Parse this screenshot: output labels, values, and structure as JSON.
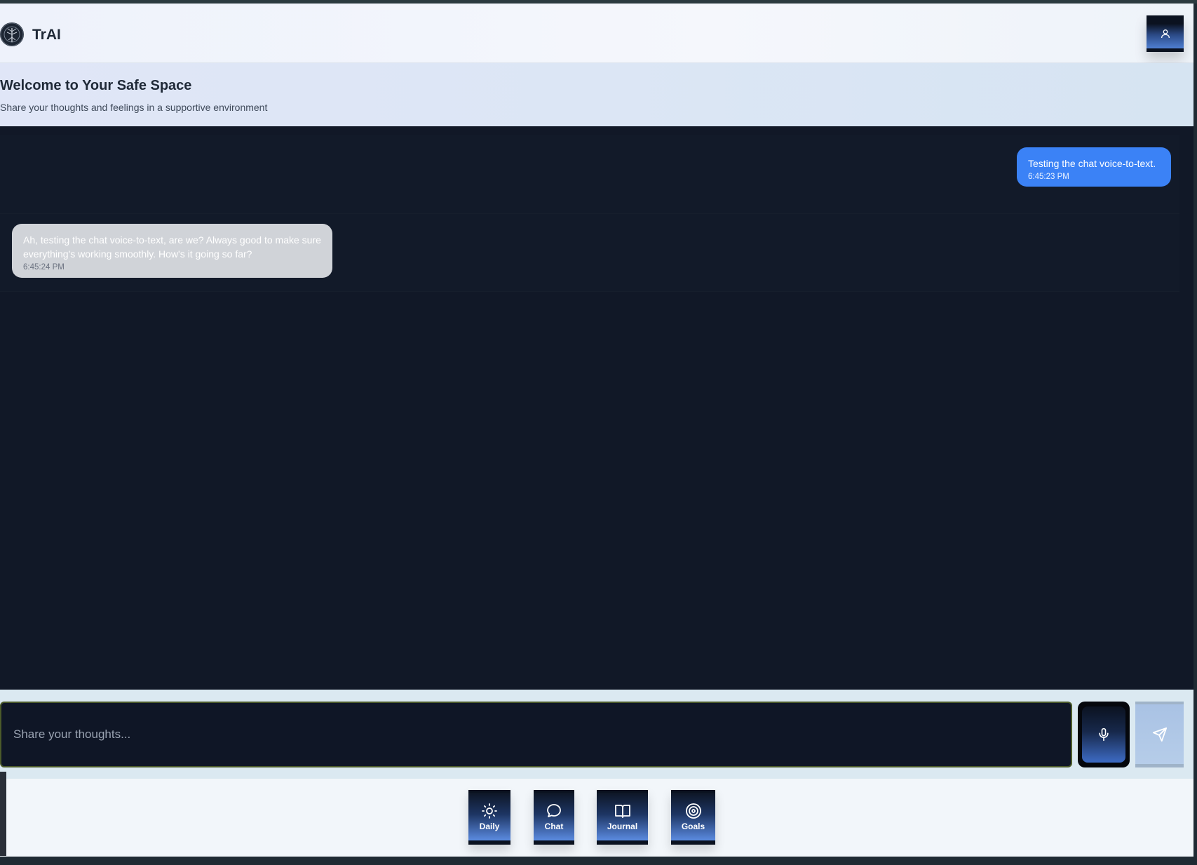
{
  "app": {
    "title": "TrAI"
  },
  "welcome": {
    "title": "Welcome to Your Safe Space",
    "subtitle": "Share your thoughts and feelings in a supportive environment"
  },
  "messages": [
    {
      "sender": "user",
      "text": "Testing the chat voice-to-text.",
      "time": "6:45:23 PM"
    },
    {
      "sender": "assistant",
      "text": "Ah, testing the chat voice-to-text, are we? Always good to make sure everything's working smoothly. How's it going so far?",
      "time": "6:45:24 PM"
    }
  ],
  "input": {
    "placeholder": "Share your thoughts..."
  },
  "nav": {
    "items": [
      {
        "label": "Daily",
        "icon": "sun-icon"
      },
      {
        "label": "Chat",
        "icon": "chat-bubble-icon"
      },
      {
        "label": "Journal",
        "icon": "book-open-icon"
      },
      {
        "label": "Goals",
        "icon": "target-icon"
      }
    ]
  },
  "colors": {
    "chat_background": "#111827",
    "user_bubble": "#3b82f6",
    "assistant_bubble": "#d0d3d8",
    "accent": "#4f7fd1"
  }
}
